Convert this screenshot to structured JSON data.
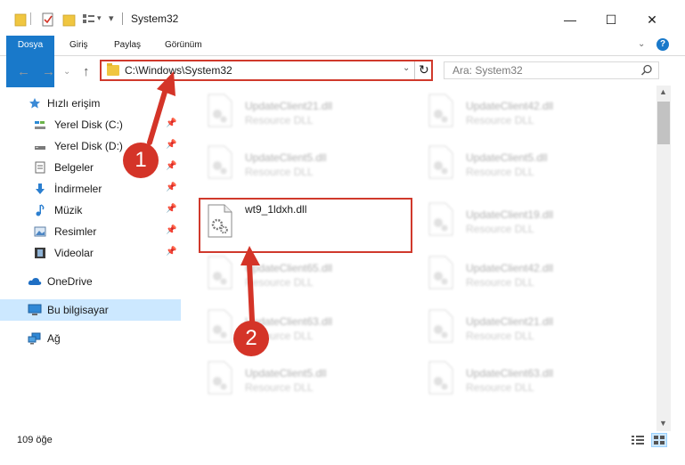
{
  "window": {
    "title": "System32",
    "minimize": "—",
    "maximize": "☐",
    "close": "✕"
  },
  "ribbon": {
    "tabs": [
      "Dosya",
      "Giriş",
      "Paylaş",
      "Görünüm"
    ]
  },
  "address": {
    "path": "C:\\Windows\\System32",
    "search_placeholder": "Ara: System32"
  },
  "nav": {
    "items": [
      {
        "label": "Hızlı erişim",
        "icon": "star-icon",
        "pinned": false
      },
      {
        "label": "Yerel Disk (C:)",
        "icon": "drive-icon",
        "pinned": true
      },
      {
        "label": "Yerel Disk (D:)",
        "icon": "drive-icon",
        "pinned": true
      },
      {
        "label": "Belgeler",
        "icon": "documents-icon",
        "pinned": true
      },
      {
        "label": "İndirmeler",
        "icon": "download-icon",
        "pinned": true
      },
      {
        "label": "Müzik",
        "icon": "music-icon",
        "pinned": true
      },
      {
        "label": "Resimler",
        "icon": "pictures-icon",
        "pinned": true
      },
      {
        "label": "Videolar",
        "icon": "videos-icon",
        "pinned": true
      },
      {
        "label": "OneDrive",
        "icon": "cloud-icon",
        "pinned": false
      },
      {
        "label": "Bu bilgisayar",
        "icon": "computer-icon",
        "pinned": false
      },
      {
        "label": "Ağ",
        "icon": "network-icon",
        "pinned": false
      }
    ]
  },
  "files": {
    "left": [
      {
        "name": "UpdateClient21.dll",
        "type": "Resource DLL"
      },
      {
        "name": "UpdateClient5.dll",
        "type": "Resource DLL"
      },
      {
        "name": "wt9_1ldxh.dll",
        "type": ""
      },
      {
        "name": "UpdateClient65.dll",
        "type": "Resource DLL"
      },
      {
        "name": "UpdateClient63.dll",
        "type": "Resource DLL"
      },
      {
        "name": "UpdateClient5.dll",
        "type": "Resource DLL"
      }
    ],
    "right": [
      {
        "name": "UpdateClient42.dll",
        "type": "Resource DLL"
      },
      {
        "name": "UpdateClient5.dll",
        "type": "Resource DLL"
      },
      {
        "name": "UpdateClient19.dll",
        "type": "Resource DLL"
      },
      {
        "name": "UpdateClient42.dll",
        "type": "Resource DLL"
      },
      {
        "name": "UpdateClient21.dll",
        "type": "Resource DLL"
      },
      {
        "name": "UpdateClient63.dll",
        "type": "Resource DLL"
      }
    ]
  },
  "status": {
    "count": "109 öğe"
  },
  "annotations": {
    "step1": "1",
    "step2": "2",
    "color": "#d43428"
  }
}
